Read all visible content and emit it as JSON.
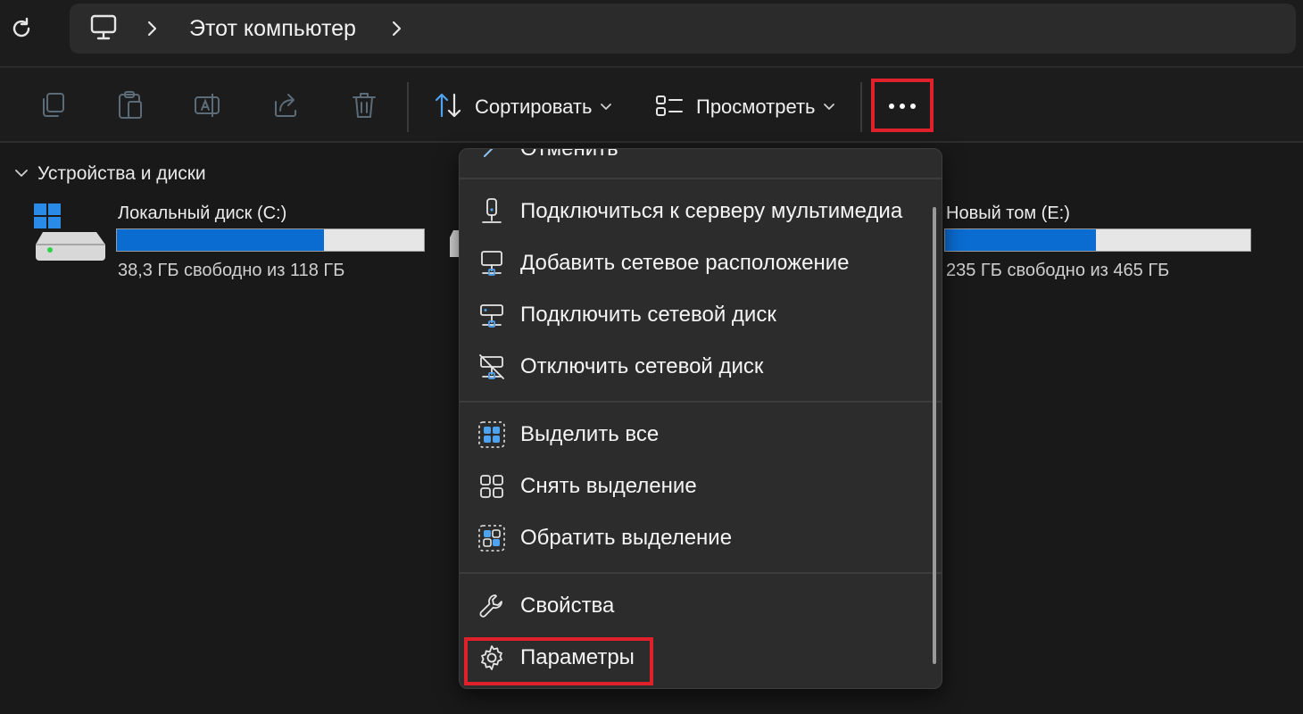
{
  "address": {
    "title": "Этот компьютер"
  },
  "toolbar": {
    "sort_label": "Сортировать",
    "view_label": "Просмотреть"
  },
  "content": {
    "group_title": "Устройства и диски",
    "drives": [
      {
        "name": "Локальный диск (C:)",
        "free": "38,3 ГБ свободно из 118 ГБ",
        "used_fraction": 0.675
      },
      {
        "name": "Новый том (E:)",
        "free": "235 ГБ свободно из 465 ГБ",
        "used_fraction": 0.495
      }
    ]
  },
  "menu": {
    "cut_off_label": "Отменить",
    "items": [
      {
        "label": "Подключиться к серверу мультимедиа",
        "icon": "media-server-icon"
      },
      {
        "label": "Добавить сетевое расположение",
        "icon": "network-location-icon"
      },
      {
        "label": "Подключить сетевой диск",
        "icon": "map-network-drive-icon"
      },
      {
        "label": "Отключить сетевой диск",
        "icon": "disconnect-network-drive-icon"
      },
      {
        "label": "Выделить все",
        "icon": "select-all-icon"
      },
      {
        "label": "Снять выделение",
        "icon": "select-none-icon"
      },
      {
        "label": "Обратить выделение",
        "icon": "invert-selection-icon"
      },
      {
        "label": "Свойства",
        "icon": "wrench-icon"
      },
      {
        "label": "Параметры",
        "icon": "gear-icon"
      }
    ]
  },
  "colors": {
    "accent": "#0a6cd1",
    "highlight": "#e0202a",
    "background": "#191919",
    "menu_bg": "#2c2c2c"
  }
}
